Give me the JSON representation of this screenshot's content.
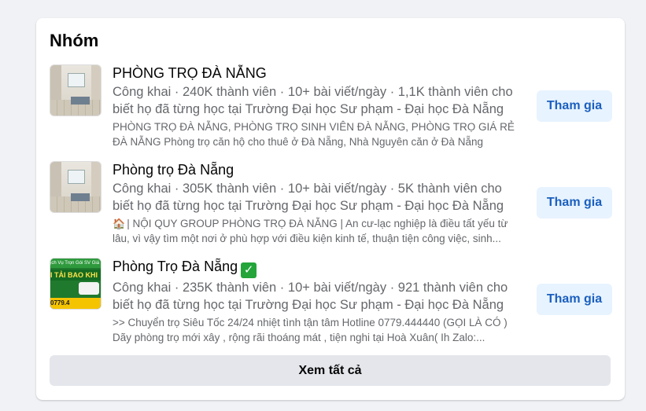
{
  "section": {
    "title": "Nhóm",
    "see_all_label": "Xem tất cả"
  },
  "groups": [
    {
      "name": "PHÒNG TRỌ ĐÀ NẴNG",
      "meta": "Công khai · 240K thành viên · 10+ bài viết/ngày · 1,1K thành viên cho biết họ đã từng học tại Trường Đại học Sư phạm - Đại học Đà Nẵng",
      "description": "PHÒNG TRỌ ĐÀ NẴNG, PHÒNG TRỌ SINH VIÊN ĐÀ NẴNG, PHÒNG TRỌ GIÁ RẺ ĐÀ NẴNG Phòng trọ căn hộ cho thuê ở Đà Nẵng, Nhà Nguyên căn ở Đà Nẵng",
      "join_label": "Tham gia",
      "thumbnail_icon": "room-photo"
    },
    {
      "name": "Phòng trọ Đà Nẵng",
      "meta": "Công khai · 305K thành viên · 10+ bài viết/ngày · 5K thành viên cho biết họ đã từng học tại Trường Đại học Sư phạm - Đại học Đà Nẵng",
      "description_icon": "🏠",
      "description": "| NỘI QUY GROUP PHÒNG TRỌ ĐÀ NẴNG | An cư-lạc nghiệp là điều tất yếu từ lâu, vì vậy tìm một nơi ở phù hợp với điều kiện kinh tế, thuận tiện công việc, sinh...",
      "join_label": "Tham gia",
      "thumbnail_icon": "room-photo"
    },
    {
      "name": "Phòng Trọ Đà Nẵng",
      "name_badge": "✓",
      "meta": "Công khai · 235K thành viên · 10+ bài viết/ngày · 921 thành viên cho biết họ đã từng học tại Trường Đại học Sư phạm - Đại học Đà Nẵng",
      "description": ">> Chuyển trọ Siêu Tốc 24/24 nhiệt tình tận tâm Hotline 0779.444440 (GỌI LÀ CÓ ) Dãy phòng trọ mới xây , rộng rãi thoáng mát , tiện nghi tại Hoà Xuân( Ih Zalo:...",
      "join_label": "Tham gia",
      "thumbnail_icon": "moving-service-ad",
      "thumbnail_text": {
        "top": "ịch Vụ Trọn Gói SV Giá R",
        "middle": "I TẢI BAO KHI",
        "bottom": "0779.4"
      }
    }
  ],
  "colors": {
    "background": "#f0f2f5",
    "card": "#ffffff",
    "join_button_bg": "#e7f3ff",
    "join_button_text": "#1b5fbf",
    "see_all_bg": "#e4e6eb",
    "secondary_text": "#65676b",
    "check_badge": "#23a53a"
  }
}
